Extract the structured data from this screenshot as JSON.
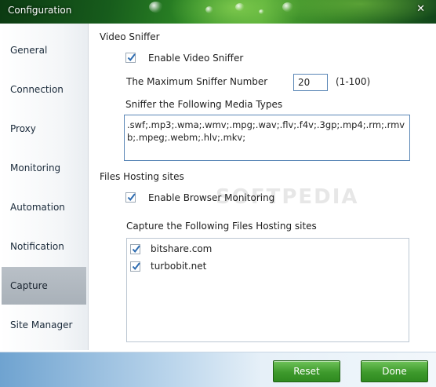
{
  "window": {
    "title": "Configuration",
    "close_glyph": "✕"
  },
  "sidebar": {
    "items": [
      {
        "label": "General"
      },
      {
        "label": "Connection"
      },
      {
        "label": "Proxy"
      },
      {
        "label": "Monitoring"
      },
      {
        "label": "Automation"
      },
      {
        "label": "Notification"
      },
      {
        "label": "Capture",
        "active": true
      },
      {
        "label": "Site Manager"
      }
    ]
  },
  "video_sniffer": {
    "section_title": "Video Sniffer",
    "enable_label": "Enable Video Sniffer",
    "enable_checked": true,
    "max_number_label": "The Maximum Sniffer Number",
    "max_number_value": "20",
    "max_number_range": "(1-100)",
    "media_types_label": "Sniffer the Following Media Types",
    "media_types_value": ".swf;.mp3;.wma;.wmv;.mpg;.wav;.flv;.f4v;.3gp;.mp4;.rm;.rmvb;.mpeg;.webm;.hlv;.mkv;"
  },
  "hosting": {
    "section_title": "Files Hosting sites",
    "enable_label": "Enable Browser Monitoring",
    "enable_checked": true,
    "capture_label": "Capture the Following Files Hosting sites",
    "sites": [
      {
        "label": "bitshare.com",
        "checked": true
      },
      {
        "label": "turbobit.net",
        "checked": true
      }
    ]
  },
  "watermark": "SOFTPEDIA",
  "buttons": {
    "reset_label": "Reset",
    "done_label": "Done"
  },
  "colors": {
    "accent_green": "#3e9a2c",
    "active_nav": "#b0b8c0",
    "input_border": "#5a86b6",
    "check_mark": "#2c6bb0"
  }
}
